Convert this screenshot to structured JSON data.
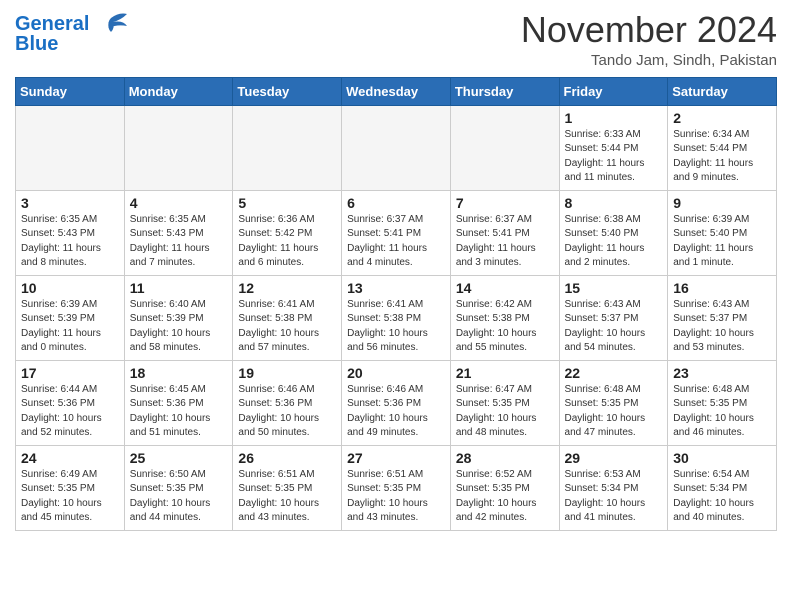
{
  "header": {
    "logo_line1": "General",
    "logo_line2": "Blue",
    "month": "November 2024",
    "location": "Tando Jam, Sindh, Pakistan"
  },
  "weekdays": [
    "Sunday",
    "Monday",
    "Tuesday",
    "Wednesday",
    "Thursday",
    "Friday",
    "Saturday"
  ],
  "weeks": [
    [
      {
        "day": "",
        "info": ""
      },
      {
        "day": "",
        "info": ""
      },
      {
        "day": "",
        "info": ""
      },
      {
        "day": "",
        "info": ""
      },
      {
        "day": "",
        "info": ""
      },
      {
        "day": "1",
        "info": "Sunrise: 6:33 AM\nSunset: 5:44 PM\nDaylight: 11 hours and 11 minutes."
      },
      {
        "day": "2",
        "info": "Sunrise: 6:34 AM\nSunset: 5:44 PM\nDaylight: 11 hours and 9 minutes."
      }
    ],
    [
      {
        "day": "3",
        "info": "Sunrise: 6:35 AM\nSunset: 5:43 PM\nDaylight: 11 hours and 8 minutes."
      },
      {
        "day": "4",
        "info": "Sunrise: 6:35 AM\nSunset: 5:43 PM\nDaylight: 11 hours and 7 minutes."
      },
      {
        "day": "5",
        "info": "Sunrise: 6:36 AM\nSunset: 5:42 PM\nDaylight: 11 hours and 6 minutes."
      },
      {
        "day": "6",
        "info": "Sunrise: 6:37 AM\nSunset: 5:41 PM\nDaylight: 11 hours and 4 minutes."
      },
      {
        "day": "7",
        "info": "Sunrise: 6:37 AM\nSunset: 5:41 PM\nDaylight: 11 hours and 3 minutes."
      },
      {
        "day": "8",
        "info": "Sunrise: 6:38 AM\nSunset: 5:40 PM\nDaylight: 11 hours and 2 minutes."
      },
      {
        "day": "9",
        "info": "Sunrise: 6:39 AM\nSunset: 5:40 PM\nDaylight: 11 hours and 1 minute."
      }
    ],
    [
      {
        "day": "10",
        "info": "Sunrise: 6:39 AM\nSunset: 5:39 PM\nDaylight: 11 hours and 0 minutes."
      },
      {
        "day": "11",
        "info": "Sunrise: 6:40 AM\nSunset: 5:39 PM\nDaylight: 10 hours and 58 minutes."
      },
      {
        "day": "12",
        "info": "Sunrise: 6:41 AM\nSunset: 5:38 PM\nDaylight: 10 hours and 57 minutes."
      },
      {
        "day": "13",
        "info": "Sunrise: 6:41 AM\nSunset: 5:38 PM\nDaylight: 10 hours and 56 minutes."
      },
      {
        "day": "14",
        "info": "Sunrise: 6:42 AM\nSunset: 5:38 PM\nDaylight: 10 hours and 55 minutes."
      },
      {
        "day": "15",
        "info": "Sunrise: 6:43 AM\nSunset: 5:37 PM\nDaylight: 10 hours and 54 minutes."
      },
      {
        "day": "16",
        "info": "Sunrise: 6:43 AM\nSunset: 5:37 PM\nDaylight: 10 hours and 53 minutes."
      }
    ],
    [
      {
        "day": "17",
        "info": "Sunrise: 6:44 AM\nSunset: 5:36 PM\nDaylight: 10 hours and 52 minutes."
      },
      {
        "day": "18",
        "info": "Sunrise: 6:45 AM\nSunset: 5:36 PM\nDaylight: 10 hours and 51 minutes."
      },
      {
        "day": "19",
        "info": "Sunrise: 6:46 AM\nSunset: 5:36 PM\nDaylight: 10 hours and 50 minutes."
      },
      {
        "day": "20",
        "info": "Sunrise: 6:46 AM\nSunset: 5:36 PM\nDaylight: 10 hours and 49 minutes."
      },
      {
        "day": "21",
        "info": "Sunrise: 6:47 AM\nSunset: 5:35 PM\nDaylight: 10 hours and 48 minutes."
      },
      {
        "day": "22",
        "info": "Sunrise: 6:48 AM\nSunset: 5:35 PM\nDaylight: 10 hours and 47 minutes."
      },
      {
        "day": "23",
        "info": "Sunrise: 6:48 AM\nSunset: 5:35 PM\nDaylight: 10 hours and 46 minutes."
      }
    ],
    [
      {
        "day": "24",
        "info": "Sunrise: 6:49 AM\nSunset: 5:35 PM\nDaylight: 10 hours and 45 minutes."
      },
      {
        "day": "25",
        "info": "Sunrise: 6:50 AM\nSunset: 5:35 PM\nDaylight: 10 hours and 44 minutes."
      },
      {
        "day": "26",
        "info": "Sunrise: 6:51 AM\nSunset: 5:35 PM\nDaylight: 10 hours and 43 minutes."
      },
      {
        "day": "27",
        "info": "Sunrise: 6:51 AM\nSunset: 5:35 PM\nDaylight: 10 hours and 43 minutes."
      },
      {
        "day": "28",
        "info": "Sunrise: 6:52 AM\nSunset: 5:35 PM\nDaylight: 10 hours and 42 minutes."
      },
      {
        "day": "29",
        "info": "Sunrise: 6:53 AM\nSunset: 5:34 PM\nDaylight: 10 hours and 41 minutes."
      },
      {
        "day": "30",
        "info": "Sunrise: 6:54 AM\nSunset: 5:34 PM\nDaylight: 10 hours and 40 minutes."
      }
    ]
  ]
}
